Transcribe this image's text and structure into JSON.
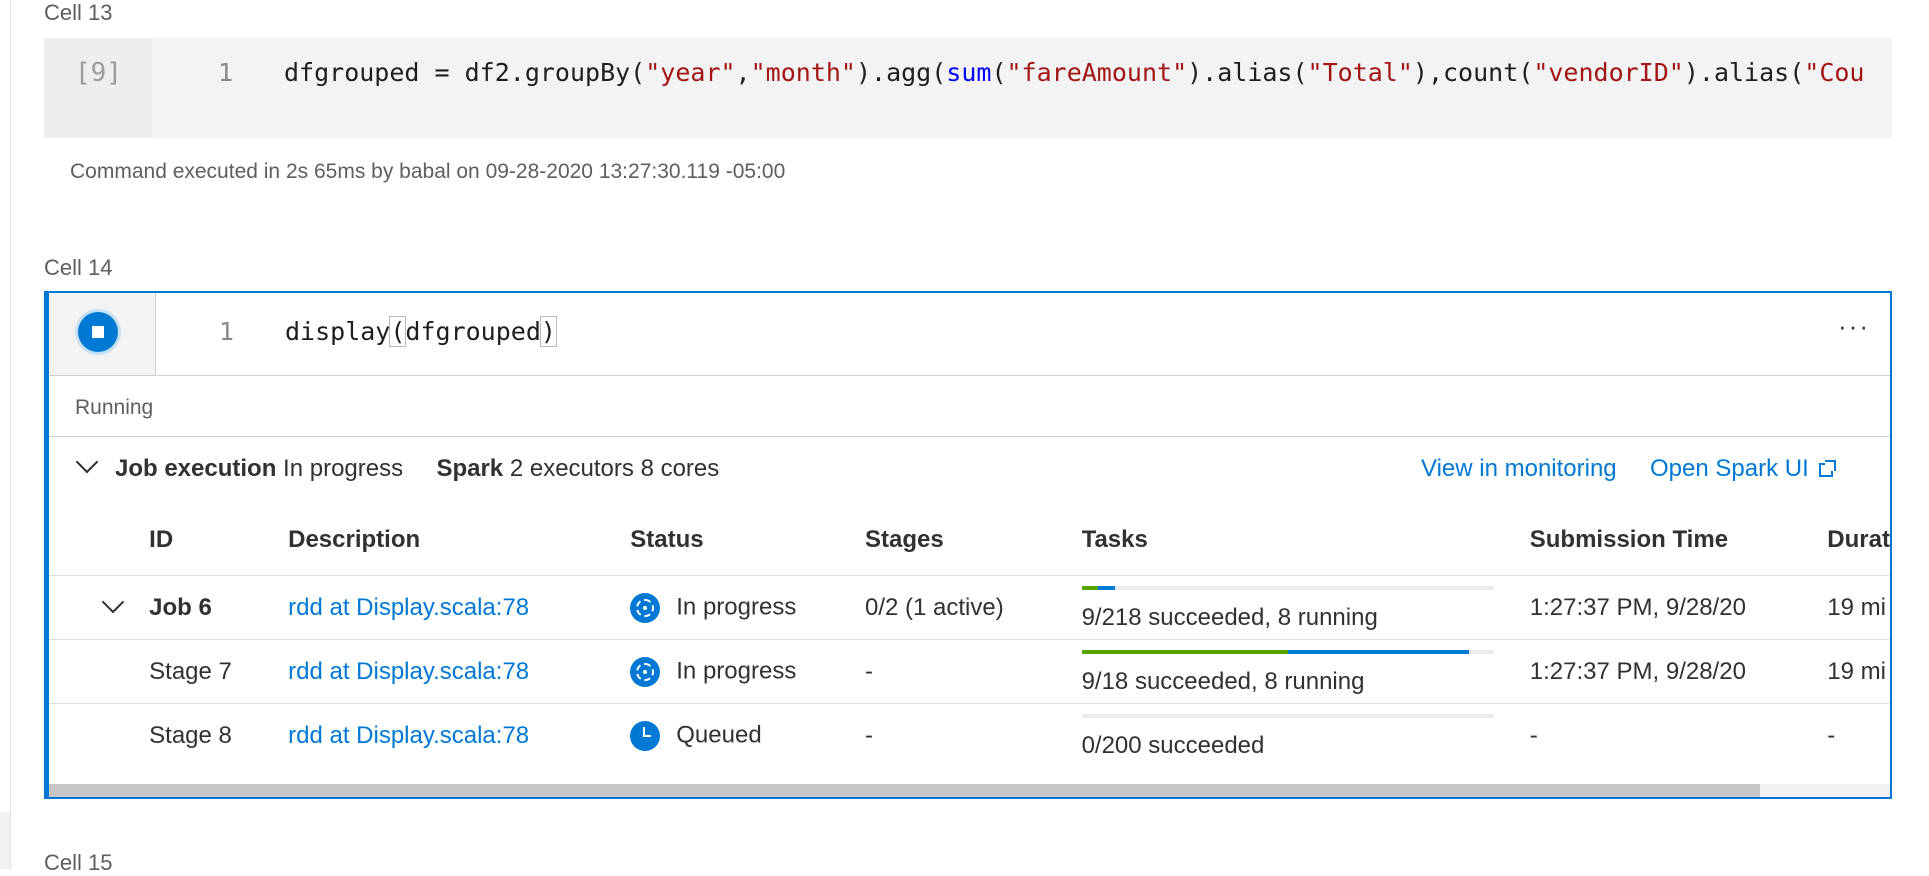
{
  "cells": {
    "cell13": {
      "label": "Cell 13",
      "exec_count": "[9]",
      "line_no": "1",
      "code_tokens": [
        {
          "text": "dfgrouped = df2.groupBy(",
          "cls": ""
        },
        {
          "text": "\"year\"",
          "cls": "str"
        },
        {
          "text": ",",
          "cls": ""
        },
        {
          "text": "\"month\"",
          "cls": "str"
        },
        {
          "text": ").agg(",
          "cls": ""
        },
        {
          "text": "sum",
          "cls": "fn"
        },
        {
          "text": "(",
          "cls": ""
        },
        {
          "text": "\"fareAmount\"",
          "cls": "str"
        },
        {
          "text": ").alias(",
          "cls": ""
        },
        {
          "text": "\"Total\"",
          "cls": "str"
        },
        {
          "text": "),count(",
          "cls": ""
        },
        {
          "text": "\"vendorID\"",
          "cls": "str"
        },
        {
          "text": ").alias(",
          "cls": ""
        },
        {
          "text": "\"Cou",
          "cls": "str"
        }
      ],
      "status": "Command executed in 2s 65ms by babal on 09-28-2020 13:27:30.119 -05:00"
    },
    "cell14": {
      "label": "Cell 14",
      "line_no": "1",
      "code_fn": "display",
      "code_open": "(",
      "code_arg": "dfgrouped",
      "code_close": ")",
      "more": "···",
      "running": "Running",
      "job_header": {
        "job_label": "Job execution",
        "job_state": "In progress",
        "spark_label": "Spark",
        "spark_info": "2 executors 8 cores",
        "view_monitoring": "View in monitoring",
        "open_spark_ui": "Open Spark UI"
      },
      "table": {
        "headers": [
          "ID",
          "Description",
          "Status",
          "Stages",
          "Tasks",
          "Submission Time",
          "Durat"
        ],
        "rows": [
          {
            "id": "Job 6",
            "desc": "rdd at Display.scala:78",
            "status": "In progress",
            "stages": "0/2 (1 active)",
            "tasks": "9/218 succeeded, 8 running",
            "tasks_succeeded_pct": 4,
            "tasks_running_pct": 4,
            "submitted": "1:27:37 PM, 9/28/20",
            "duration": "19 mi"
          },
          {
            "id": "Stage 7",
            "desc": "rdd at Display.scala:78",
            "status": "In progress",
            "stages": "-",
            "tasks": "9/18 succeeded, 8 running",
            "tasks_succeeded_pct": 50,
            "tasks_running_pct": 44,
            "submitted": "1:27:37 PM, 9/28/20",
            "duration": "19 mi"
          },
          {
            "id": "Stage 8",
            "desc": "rdd at Display.scala:78",
            "status": "Queued",
            "stages": "-",
            "tasks": "0/200 succeeded",
            "tasks_succeeded_pct": 0,
            "tasks_running_pct": 0,
            "submitted": "-",
            "duration": "-"
          }
        ]
      }
    },
    "cell15": {
      "label": "Cell 15"
    }
  },
  "colors": {
    "accent": "#0078d4",
    "succeeded": "#57a300",
    "string": "#a31515",
    "keyword_fn": "#0000ff"
  },
  "icons": {
    "stop": "stop-icon",
    "expand": "chevron-down-icon",
    "external": "external-link-icon",
    "in_progress": "in-progress-icon",
    "queued": "clock-icon"
  }
}
